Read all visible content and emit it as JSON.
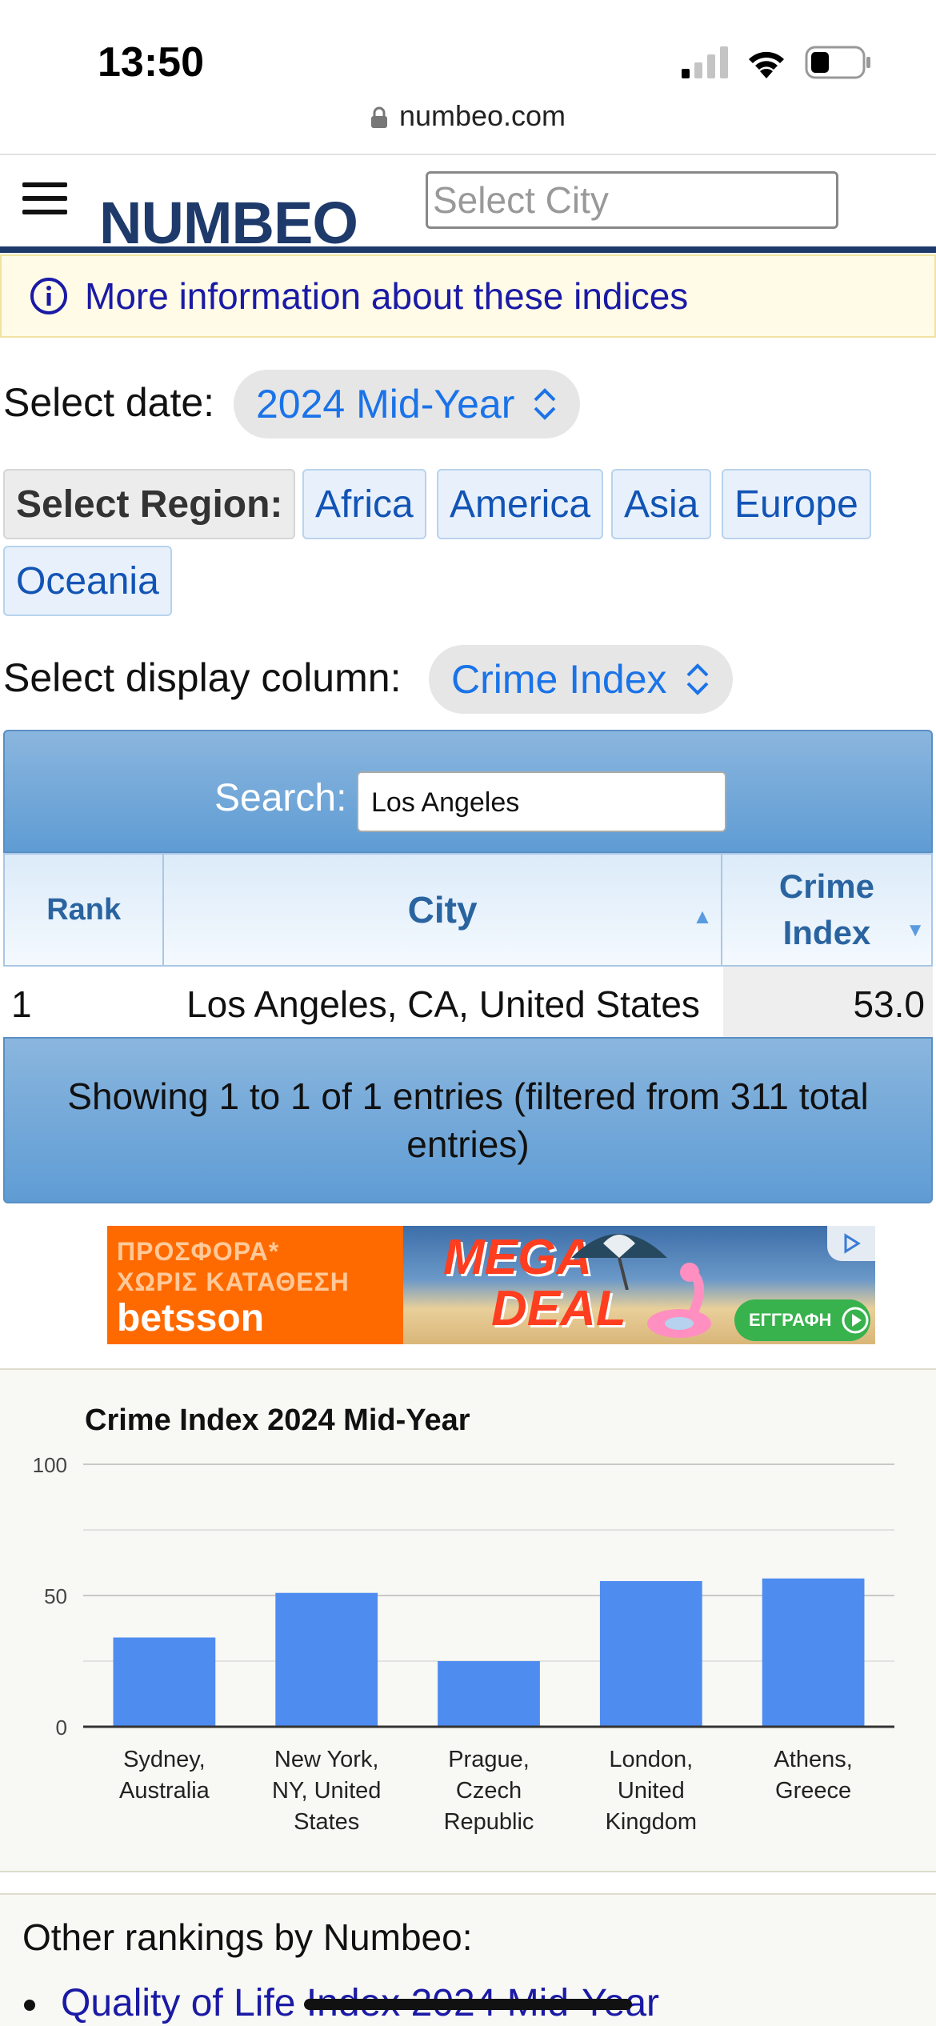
{
  "status": {
    "time": "13:50"
  },
  "browser": {
    "url": "numbeo.com"
  },
  "header": {
    "logo": "NUMBEO",
    "city_placeholder": "Select City"
  },
  "info": {
    "text": "More information about these indices"
  },
  "date_select": {
    "label": "Select date:",
    "value": "2024 Mid-Year"
  },
  "regions": {
    "label": "Select Region:",
    "items": [
      "Africa",
      "America",
      "Asia",
      "Europe",
      "Oceania"
    ]
  },
  "column_select": {
    "label": "Select display column:",
    "value": "Crime Index"
  },
  "search": {
    "label": "Search:",
    "value": "Los Angeles"
  },
  "table": {
    "headers": {
      "rank": "Rank",
      "city": "City",
      "crime_line1": "Crime",
      "crime_line2": "Index"
    },
    "rows": [
      {
        "rank": "1",
        "city": "Los Angeles, CA, United States",
        "crime_index": "53.0"
      }
    ],
    "footer": "Showing 1 to 1 of 1 entries (filtered from 311 total entries)"
  },
  "ad": {
    "line1": "ΠΡΟΣΦΟΡΑ*",
    "line2": "ΧΩΡΙΣ ΚΑΤΑΘΕΣΗ",
    "brand": "betsson",
    "mega": "MEGA",
    "deal": "DEAL",
    "cta": "ΕΓΓΡΑΦΗ"
  },
  "chart_data": {
    "type": "bar",
    "title": "Crime Index 2024 Mid-Year",
    "categories": [
      [
        "Sydney,",
        "Australia"
      ],
      [
        "New York,",
        "NY, United",
        "States"
      ],
      [
        "Prague,",
        "Czech",
        "Republic"
      ],
      [
        "London,",
        "United",
        "Kingdom"
      ],
      [
        "Athens,",
        "Greece"
      ]
    ],
    "values": [
      34,
      51,
      25,
      55.5,
      56.5
    ],
    "ylim": [
      0,
      100
    ],
    "yticks": [
      "0",
      "50",
      "100"
    ],
    "bar_color": "#4f8cf0",
    "grid": true
  },
  "other": {
    "title": "Other rankings by Numbeo:",
    "first_link": "Quality of Life Index 2024 Mid-Year"
  }
}
